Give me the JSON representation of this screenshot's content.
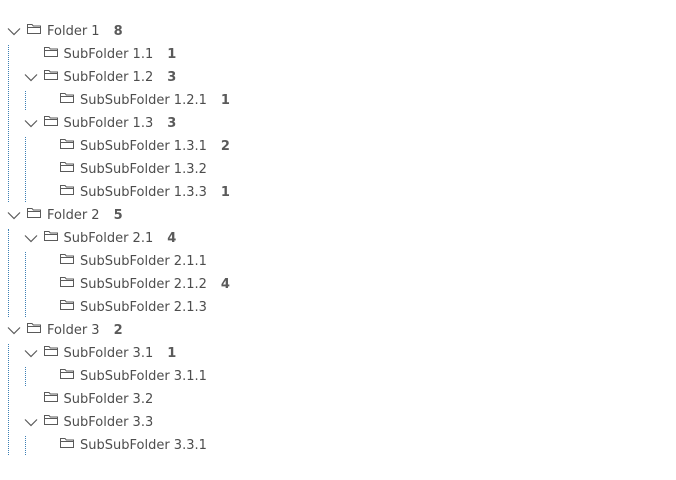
{
  "tree": {
    "nodes": [
      {
        "label": "Folder 1",
        "count": "8",
        "depth": 0,
        "expanded": true
      },
      {
        "label": "SubFolder 1.1",
        "count": "1",
        "depth": 1,
        "expanded": null
      },
      {
        "label": "SubFolder 1.2",
        "count": "3",
        "depth": 1,
        "expanded": true
      },
      {
        "label": "SubSubFolder 1.2.1",
        "count": "1",
        "depth": 2,
        "expanded": null
      },
      {
        "label": "SubFolder 1.3",
        "count": "3",
        "depth": 1,
        "expanded": true
      },
      {
        "label": "SubSubFolder 1.3.1",
        "count": "2",
        "depth": 2,
        "expanded": null
      },
      {
        "label": "SubSubFolder 1.3.2",
        "count": "",
        "depth": 2,
        "expanded": null
      },
      {
        "label": "SubSubFolder 1.3.3",
        "count": "1",
        "depth": 2,
        "expanded": null
      },
      {
        "label": "Folder 2",
        "count": "5",
        "depth": 0,
        "expanded": true
      },
      {
        "label": "SubFolder 2.1",
        "count": "4",
        "depth": 1,
        "expanded": true
      },
      {
        "label": "SubSubFolder 2.1.1",
        "count": "",
        "depth": 2,
        "expanded": null
      },
      {
        "label": "SubSubFolder 2.1.2",
        "count": "4",
        "depth": 2,
        "expanded": null
      },
      {
        "label": "SubSubFolder 2.1.3",
        "count": "",
        "depth": 2,
        "expanded": null
      },
      {
        "label": "Folder 3",
        "count": "2",
        "depth": 0,
        "expanded": true
      },
      {
        "label": "SubFolder 3.1",
        "count": "1",
        "depth": 1,
        "expanded": true
      },
      {
        "label": "SubSubFolder 3.1.1",
        "count": "",
        "depth": 2,
        "expanded": null
      },
      {
        "label": "SubFolder 3.2",
        "count": "",
        "depth": 1,
        "expanded": null
      },
      {
        "label": "SubFolder 3.3",
        "count": "",
        "depth": 1,
        "expanded": true
      },
      {
        "label": "SubSubFolder 3.3.1",
        "count": "",
        "depth": 2,
        "expanded": null
      }
    ]
  },
  "colors": {
    "guide_line": "#3c7fb4",
    "text": "#4d4d4d",
    "icon": "#5a5a5a"
  },
  "icons": {
    "expand": "chevron-down-icon",
    "node": "folder-icon"
  }
}
